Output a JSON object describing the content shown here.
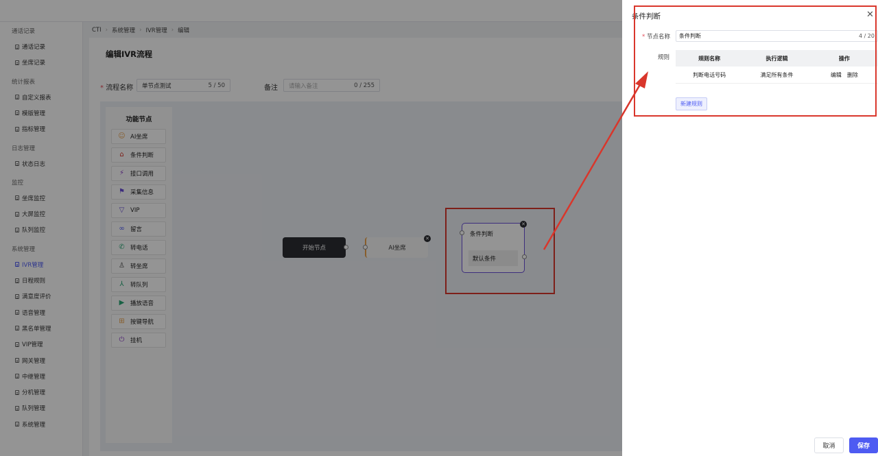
{
  "breadcrumb": [
    "CTI",
    "系统管理",
    "IVR管理",
    "编辑"
  ],
  "sidebar": {
    "groups": [
      {
        "label": "通话记录",
        "items": [
          "通话记录",
          "坐席记录"
        ]
      },
      {
        "label": "统计报表",
        "items": [
          "自定义报表",
          "模版管理",
          "指标管理"
        ]
      },
      {
        "label": "日志管理",
        "items": [
          "状态日志"
        ]
      },
      {
        "label": "监控",
        "items": [
          "坐席监控",
          "大屏监控",
          "队列监控"
        ]
      },
      {
        "label": "系统管理",
        "items": [
          "IVR管理",
          "日程规则",
          "满意度评价",
          "语音管理",
          "黑名单管理",
          "VIP管理",
          "网关管理",
          "中继管理",
          "分机管理",
          "队列管理",
          "系统管理"
        ]
      }
    ],
    "active_item": "IVR管理",
    "active_color": "#4e5bf2"
  },
  "page": {
    "title": "编辑IVR流程",
    "flow_name_label": "流程名称",
    "flow_name_value": "单节点测试",
    "flow_name_count": "5 / 50",
    "remark_label": "备注",
    "remark_placeholder": "请输入备注",
    "remark_count": "0 / 255"
  },
  "palette": {
    "title": "功能节点",
    "items": [
      {
        "label": "AI坐席",
        "icon": "robot-icon",
        "color": "#e8a04a"
      },
      {
        "label": "条件判断",
        "icon": "branch-icon",
        "color": "#d9362b"
      },
      {
        "label": "接口调用",
        "icon": "plug-icon",
        "color": "#8b3fc7"
      },
      {
        "label": "采集信息",
        "icon": "collect-icon",
        "color": "#6a4fd8"
      },
      {
        "label": "VIP",
        "icon": "vip-icon",
        "color": "#6a4fd8"
      },
      {
        "label": "留言",
        "icon": "voicemail-icon",
        "color": "#4e5bf2"
      },
      {
        "label": "转电话",
        "icon": "phone-icon",
        "color": "#2aa876"
      },
      {
        "label": "转坐席",
        "icon": "agent-icon",
        "color": "#444444"
      },
      {
        "label": "转队列",
        "icon": "queue-icon",
        "color": "#2aa876"
      },
      {
        "label": "播放语音",
        "icon": "play-icon",
        "color": "#2aa876"
      },
      {
        "label": "按键导航",
        "icon": "keypad-icon",
        "color": "#e8a04a"
      },
      {
        "label": "挂机",
        "icon": "power-icon",
        "color": "#8b3fc7"
      }
    ]
  },
  "flow": {
    "start_label": "开始节点",
    "ai_label": "AI坐席",
    "cond_title": "条件判断",
    "cond_default": "默认条件"
  },
  "drawer": {
    "title": "条件判断",
    "node_name_label": "节点名称",
    "node_name_value": "条件判断",
    "node_name_count": "4 / 20",
    "rules_label": "规则",
    "table_headers": [
      "规则名称",
      "执行逻辑",
      "操作"
    ],
    "rows": [
      {
        "name": "判断电话号码",
        "logic": "满足所有条件",
        "edit": "编辑",
        "delete": "删除"
      }
    ],
    "new_rule": "新建规则",
    "cancel": "取消",
    "save": "保存"
  }
}
